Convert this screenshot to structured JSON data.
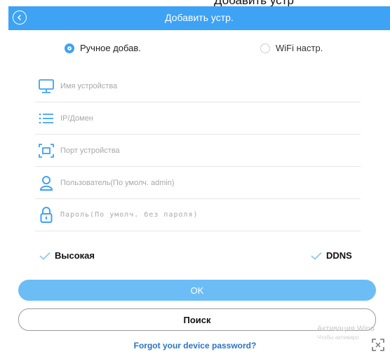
{
  "header": {
    "cut_title": "Добавить устр",
    "title": "Добавить устр."
  },
  "modes": {
    "manual": "Ручное добав.",
    "wifi": "WiFi настр."
  },
  "fields": {
    "device_name": "Имя устройства",
    "ip_domain": "IP/Домен",
    "device_port": "Порт устройства",
    "user": "Пользователь(По умолч. admin)",
    "password": "Пароль(По умолч. без пароля)"
  },
  "options": {
    "high": "Высокая",
    "ddns": "DDNS"
  },
  "buttons": {
    "ok": "OK",
    "search": "Поиск"
  },
  "links": {
    "forgot": "Forgot your device password?"
  },
  "watermark": {
    "line1": "Активация Wind",
    "line2": "Чтобы активиро"
  },
  "colors": {
    "accent": "#3ea2f5",
    "ok_button": "#6cbdf6",
    "link": "#2a74c6"
  }
}
